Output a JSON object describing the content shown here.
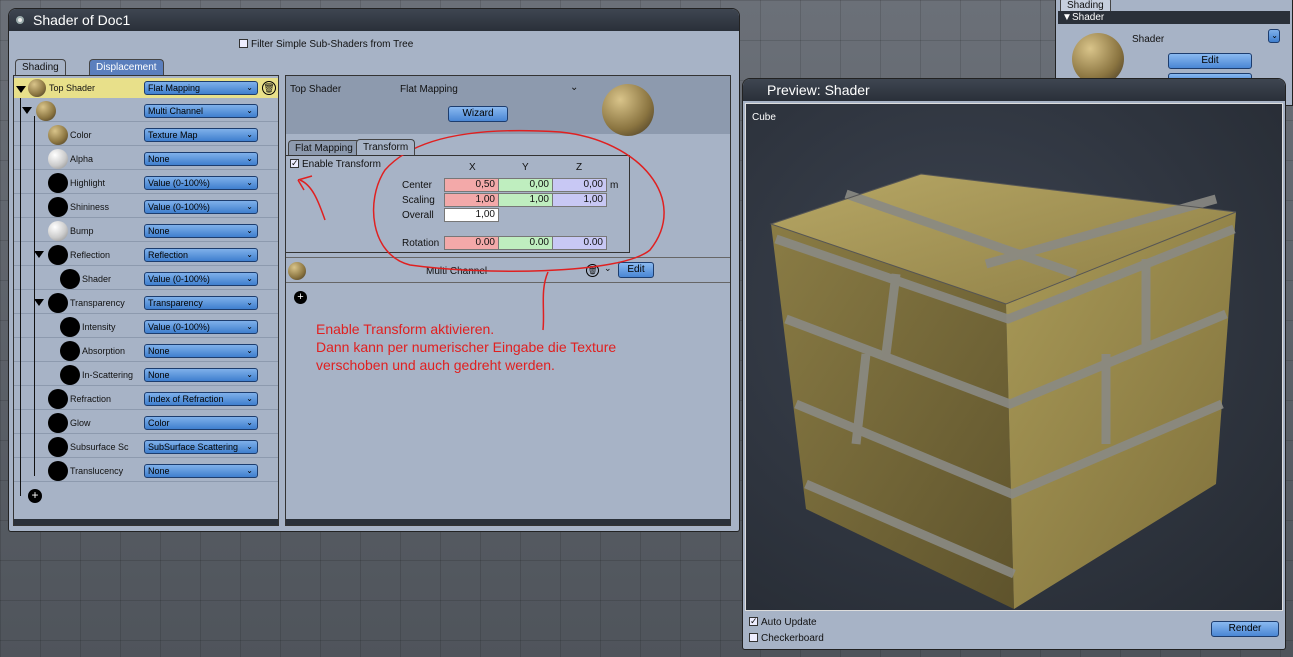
{
  "main_window": {
    "title": "Shader of Doc1",
    "filter_label": "Filter Simple Sub-Shaders from Tree",
    "tabs": [
      "Shading",
      "Displacement"
    ]
  },
  "tree": {
    "top": {
      "label": "Top Shader",
      "dropdown": "Flat Mapping"
    },
    "rows": [
      {
        "label": "",
        "dropdown": "Multi Channel",
        "ball": "texture"
      },
      {
        "label": "Color",
        "dropdown": "Texture Map",
        "ball": "texture"
      },
      {
        "label": "Alpha",
        "dropdown": "None",
        "ball": "white"
      },
      {
        "label": "Highlight",
        "dropdown": "Value (0-100%)",
        "ball": "black"
      },
      {
        "label": "Shininess",
        "dropdown": "Value (0-100%)",
        "ball": "black"
      },
      {
        "label": "Bump",
        "dropdown": "None",
        "ball": "white"
      },
      {
        "label": "Reflection",
        "dropdown": "Reflection",
        "ball": "black"
      },
      {
        "label": "Shader",
        "dropdown": "Value (0-100%)",
        "ball": "black"
      },
      {
        "label": "Transparency",
        "dropdown": "Transparency",
        "ball": "black"
      },
      {
        "label": "Intensity",
        "dropdown": "Value (0-100%)",
        "ball": "black"
      },
      {
        "label": "Absorption",
        "dropdown": "None",
        "ball": "black"
      },
      {
        "label": "In-Scattering",
        "dropdown": "None",
        "ball": "black"
      },
      {
        "label": "Refraction",
        "dropdown": "Index of Refraction",
        "ball": "black"
      },
      {
        "label": "Glow",
        "dropdown": "Color",
        "ball": "black"
      },
      {
        "label": "Subsurface Sc",
        "dropdown": "SubSurface Scattering",
        "ball": "black"
      },
      {
        "label": "Translucency",
        "dropdown": "None",
        "ball": "black"
      }
    ]
  },
  "detail": {
    "header_label": "Top Shader",
    "header_value": "Flat Mapping",
    "wizard": "Wizard",
    "tabs": [
      "Flat Mapping",
      "Transform"
    ],
    "enable_transform": "Enable Transform",
    "cols": [
      "X",
      "Y",
      "Z"
    ],
    "center_label": "Center",
    "center": [
      "0,50",
      "0,00",
      "0,00"
    ],
    "center_unit": "m",
    "scaling_label": "Scaling",
    "scaling": [
      "1,00",
      "1,00",
      "1,00"
    ],
    "overall_label": "Overall",
    "overall": "1,00",
    "rotation_label": "Rotation",
    "rotation": [
      "0.00",
      "0.00",
      "0.00"
    ],
    "multi_channel": "Multi Channel",
    "edit": "Edit",
    "note": [
      "Enable Transform aktivieren.",
      "Dann kann per numerischer Eingabe die Texture",
      "verschoben und auch gedreht werden."
    ]
  },
  "right_panel": {
    "tab": "Shading",
    "header": "Shader",
    "shader_label": "Shader",
    "edit": "Edit"
  },
  "preview": {
    "title": "Preview: Shader",
    "object": "Cube",
    "auto_update": "Auto Update",
    "checkerboard": "Checkerboard",
    "render": "Render"
  },
  "colors": {
    "annotation": "#e02020",
    "accent": "#4a86d4"
  }
}
